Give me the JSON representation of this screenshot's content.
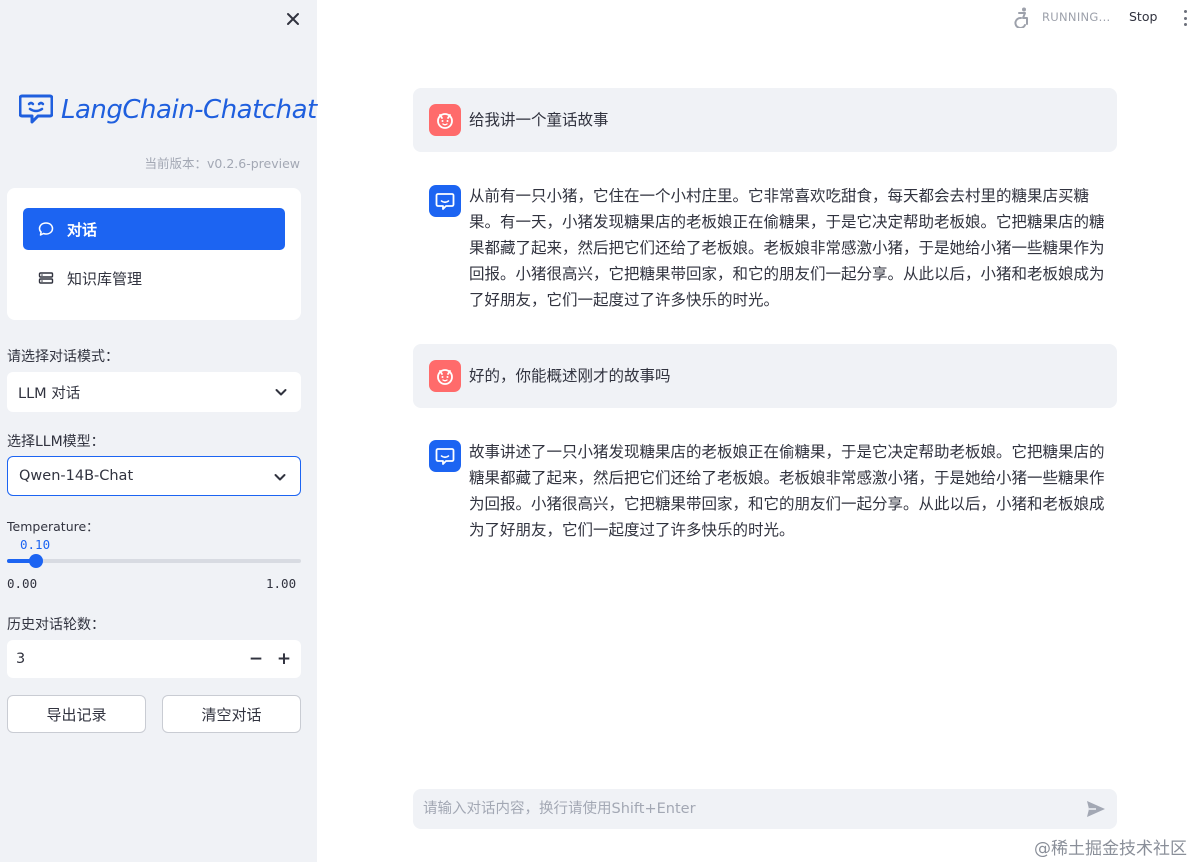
{
  "sidebar": {
    "close_icon": "close-icon",
    "logo_text": "LangChain-Chatchat",
    "version": "当前版本：v0.2.6-preview",
    "nav": [
      {
        "label": "对话",
        "icon": "chat-bubble-icon",
        "active": true
      },
      {
        "label": "知识库管理",
        "icon": "database-icon",
        "active": false
      }
    ],
    "mode_label": "请选择对话模式：",
    "mode_value": "LLM 对话",
    "model_label": "选择LLM模型：",
    "model_value": "Qwen-14B-Chat",
    "temperature_label": "Temperature：",
    "temperature_value": "0.10",
    "temperature_fraction": 0.1,
    "temperature_min": "0.00",
    "temperature_max": "1.00",
    "history_label": "历史对话轮数：",
    "history_value": "3",
    "export_label": "导出记录",
    "clear_label": "清空对话"
  },
  "topbar": {
    "status": "RUNNING...",
    "stop_label": "Stop"
  },
  "chat": {
    "messages": [
      {
        "role": "user",
        "text": "给我讲一个童话故事"
      },
      {
        "role": "assistant",
        "text": "从前有一只小猪，它住在一个小村庄里。它非常喜欢吃甜食，每天都会去村里的糖果店买糖果。有一天，小猪发现糖果店的老板娘正在偷糖果，于是它决定帮助老板娘。它把糖果店的糖果都藏了起来，然后把它们还给了老板娘。老板娘非常感激小猪，于是她给小猪一些糖果作为回报。小猪很高兴，它把糖果带回家，和它的朋友们一起分享。从此以后，小猪和老板娘成为了好朋友，它们一起度过了许多快乐的时光。"
      },
      {
        "role": "user",
        "text": "好的，你能概述刚才的故事吗"
      },
      {
        "role": "assistant",
        "text": "故事讲述了一只小猪发现糖果店的老板娘正在偷糖果，于是它决定帮助老板娘。它把糖果店的糖果都藏了起来，然后把它们还给了老板娘。老板娘非常感激小猪，于是她给小猪一些糖果作为回报。小猪很高兴，它把糖果带回家，和它的朋友们一起分享。从此以后，小猪和老板娘成为了好朋友，它们一起度过了许多快乐的时光。"
      }
    ],
    "input_placeholder": "请输入对话内容，换行请使用Shift+Enter"
  },
  "watermark": "@稀土掘金技术社区",
  "colors": {
    "accent": "#1c64f2",
    "sidebar_bg": "#f0f2f6",
    "user_avatar": "#ff6b6b"
  }
}
